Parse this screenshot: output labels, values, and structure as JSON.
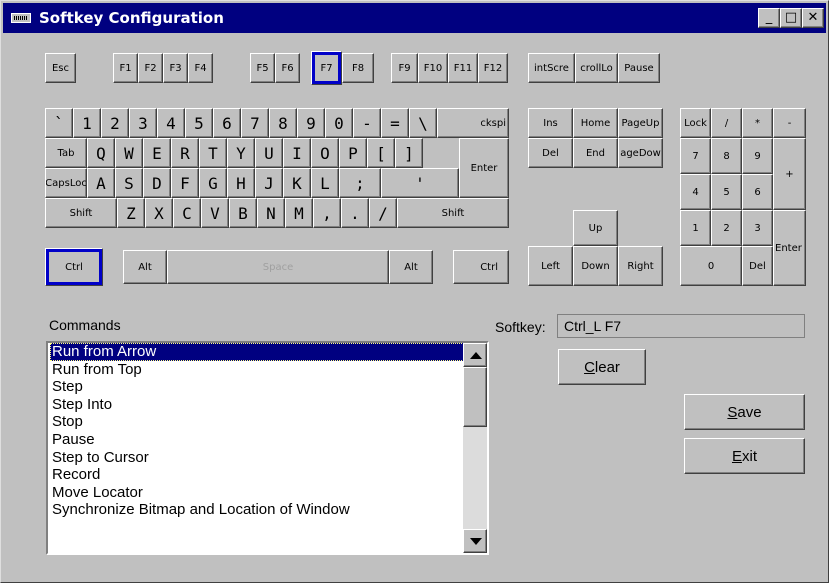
{
  "window": {
    "title": "Softkey Configuration",
    "controls": {
      "minimize": "_",
      "maximize": "□",
      "close": "✕"
    }
  },
  "keyboard": {
    "esc": "Esc",
    "f1": "F1",
    "f2": "F2",
    "f3": "F3",
    "f4": "F4",
    "f5": "F5",
    "f6": "F6",
    "f7": "F7",
    "f8": "F8",
    "f9": "F9",
    "f10": "F10",
    "f11": "F11",
    "f12": "F12",
    "printscreen": "intScre",
    "scrolllock": "crollLo",
    "pause": "Pause",
    "row1": [
      "`",
      "1",
      "2",
      "3",
      "4",
      "5",
      "6",
      "7",
      "8",
      "9",
      "0",
      "-",
      "=",
      "\\"
    ],
    "backspace": "ckspi",
    "tab": "Tab",
    "row2": [
      "Q",
      "W",
      "E",
      "R",
      "T",
      "Y",
      "U",
      "I",
      "O",
      "P",
      "[",
      "]"
    ],
    "enter": "Enter",
    "capslock": "CapsLoc",
    "row3": [
      "A",
      "S",
      "D",
      "F",
      "G",
      "H",
      "J",
      "K",
      "L",
      ";",
      "'"
    ],
    "shift_left": "Shift",
    "row4": [
      "Z",
      "X",
      "C",
      "V",
      "B",
      "N",
      "M",
      ",",
      ".",
      "/"
    ],
    "shift_right": "Shift",
    "ctrl_left": "Ctrl",
    "alt_left": "Alt",
    "space": "Space",
    "alt_right": "Alt",
    "ctrl_right": "Ctrl",
    "nav": {
      "ins": "Ins",
      "home": "Home",
      "pageup": "PageUp",
      "del": "Del",
      "end": "End",
      "pagedown": "ageDow"
    },
    "arrows": {
      "up": "Up",
      "left": "Left",
      "down": "Down",
      "right": "Right"
    },
    "numpad": {
      "numlock": "Lock",
      "divide": "/",
      "multiply": "*",
      "minus": "-",
      "n7": "7",
      "n8": "8",
      "n9": "9",
      "plus": "+",
      "n4": "4",
      "n5": "5",
      "n6": "6",
      "n1": "1",
      "n2": "2",
      "n3": "3",
      "enter": "Enter",
      "n0": "0",
      "del": "Del"
    }
  },
  "commands": {
    "label": "Commands",
    "items": [
      "Run from Arrow",
      "Run from Top",
      "Step",
      "Step Into",
      "Stop",
      "Pause",
      "Step to Cursor",
      "Record",
      "Move Locator",
      "Synchronize Bitmap and Location of Window"
    ],
    "selected_index": 0
  },
  "softkey": {
    "label": "Softkey:",
    "value": "Ctrl_L F7"
  },
  "buttons": {
    "clear": "Clear",
    "save": "Save",
    "exit": "Exit"
  },
  "icons": {
    "window": "keyboard-icon",
    "scroll_up": "arrow-up-icon",
    "scroll_down": "arrow-down-icon"
  },
  "colors": {
    "titlebar": "#000080",
    "selection": "#000080",
    "key_highlight": "#0000c8",
    "face": "#c0c0c0"
  }
}
